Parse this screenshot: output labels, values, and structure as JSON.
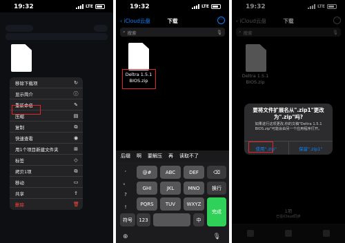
{
  "status": {
    "time": "19:32",
    "network": "LTE"
  },
  "panel1": {
    "menu_items": [
      {
        "label": "移除下载项",
        "icon": "↻"
      },
      {
        "label": "显示简介",
        "icon": "ⓘ"
      },
      {
        "label": "重新命名",
        "icon": "✎"
      },
      {
        "label": "压缩",
        "icon": "▤"
      },
      {
        "label": "复制",
        "icon": "⧉"
      },
      {
        "label": "快速查看",
        "icon": "◉"
      },
      {
        "label": "用1个项目新建文件夹",
        "icon": "⊞"
      },
      {
        "label": "标签",
        "icon": "◇"
      },
      {
        "label": "拷贝1项",
        "icon": "⧉"
      },
      {
        "label": "移动",
        "icon": "▭"
      },
      {
        "label": "共享",
        "icon": "⇪"
      },
      {
        "label": "删除",
        "icon": "🗑"
      }
    ]
  },
  "panel2": {
    "back_label": "iCloud云盘",
    "title": "下载",
    "search_placeholder": "搜索",
    "file_name_line1": "Deltra 1.5.1",
    "file_name_line2": "BIOS.zip",
    "suggestions": [
      "后缀",
      "啊",
      "要解压",
      "再",
      "读取不了"
    ],
    "keys": {
      "row1": [
        "@#",
        "ABC",
        "DEF",
        "⌫"
      ],
      "row2": [
        "GHI",
        "JKL",
        "MNO",
        "换行"
      ],
      "row3": [
        "PQRS",
        "TUV",
        "WXYZ",
        "完成"
      ],
      "row4": [
        "符号",
        "123",
        "",
        "中"
      ],
      "side_syms": [
        ",",
        "。",
        "?",
        "!"
      ]
    }
  },
  "panel3": {
    "back_label": "iCloud云盘",
    "title": "下载",
    "search_placeholder": "搜索",
    "file_name_line1": "Deltra 1.5.1",
    "file_name_line2": "BIOS.zip",
    "dialog": {
      "title": "要将文件扩展名从\".zip1\"更改为\".zip\"吗?",
      "message": "如果进行这项更改,你的文稿\"Deltra 1.5.1 BIOS.zip\"可能会由另一个应用程序打开。",
      "use_label": "使用\".zip\"",
      "keep_label": "保留\".zip1\""
    },
    "items_count": "1项",
    "items_sub": "已在iCloud同步"
  },
  "colors": {
    "highlight": "#e3262b",
    "accent": "#0a84ff",
    "done_key": "#30d158"
  }
}
